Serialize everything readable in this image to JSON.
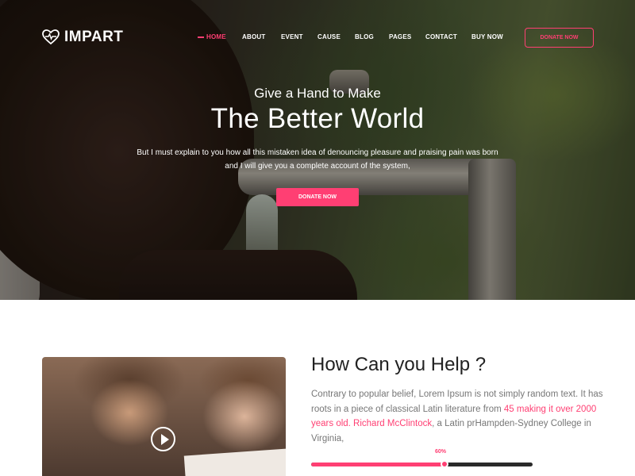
{
  "brand": {
    "name": "IMPART",
    "logo_icon": "heart-pulse-icon",
    "accent_color": "#ff3f73"
  },
  "nav": {
    "items": [
      {
        "label": "HOME",
        "active": true
      },
      {
        "label": "ABOUT",
        "active": false
      },
      {
        "label": "EVENT",
        "active": false
      },
      {
        "label": "CAUSE",
        "active": false
      },
      {
        "label": "BLOG",
        "active": false
      },
      {
        "label": "PAGES",
        "active": false
      },
      {
        "label": "CONTACT",
        "active": false
      },
      {
        "label": "BUY NOW",
        "active": false
      }
    ],
    "donate_label": "DONATE NOW"
  },
  "hero": {
    "subtitle": "Give a Hand to Make",
    "title": "The Better World",
    "description_line1": "But I must explain to you how all this mistaken idea of denouncing pleasure and praising pain was born",
    "description_line2": "and I will give you a complete account of the system,",
    "button_label": "DONATE NOW"
  },
  "help": {
    "heading": "How Can you Help ?",
    "text_part1": "Contrary to popular belief, Lorem Ipsum is not simply random text. It has roots in a piece of classical Latin literature from ",
    "text_highlight1": "45 making it over 2000 years old. Richard McClintock",
    "text_part2": ", a Latin prHampden-Sydney College in Virginia,",
    "video_icon": "play-icon",
    "progress": {
      "label": "60%",
      "value": 0.6
    }
  }
}
